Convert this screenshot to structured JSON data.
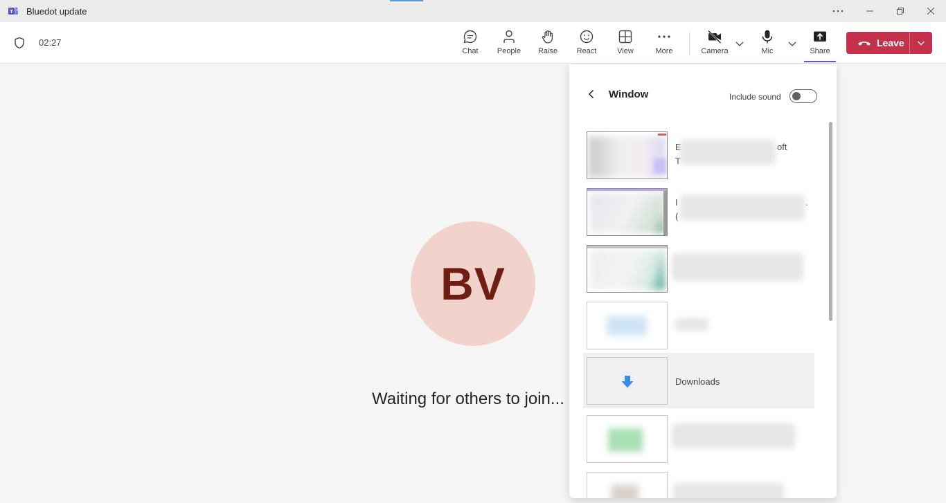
{
  "window": {
    "title": "Bluedot update"
  },
  "meeting": {
    "timer": "02:27",
    "toolbar": {
      "chat": "Chat",
      "people": "People",
      "raise": "Raise",
      "react": "React",
      "view": "View",
      "more": "More",
      "camera": "Camera",
      "mic": "Mic",
      "share": "Share",
      "leave": "Leave"
    }
  },
  "stage": {
    "avatar_initials": "BV",
    "waiting_text": "Waiting for others to join..."
  },
  "share_panel": {
    "title": "Window",
    "include_sound_label": "Include sound",
    "include_sound_on": false,
    "windows": [
      {
        "label_line1": "E",
        "label_line1_end": "oft",
        "label_line2": "T"
      },
      {
        "label_line1": "I",
        "label_line1_end": ".",
        "label_line2": "("
      },
      {
        "label_line1": ""
      },
      {
        "label_line1": ""
      },
      {
        "label_line1": "Downloads",
        "icon": "download-arrow-icon"
      },
      {
        "label_line1": ""
      },
      {
        "label_line1": ""
      }
    ]
  },
  "colors": {
    "leave_red": "#c4314b",
    "share_accent": "#5b5fc7",
    "avatar_bg": "#f1d3cc",
    "avatar_text": "#6e1e12"
  }
}
